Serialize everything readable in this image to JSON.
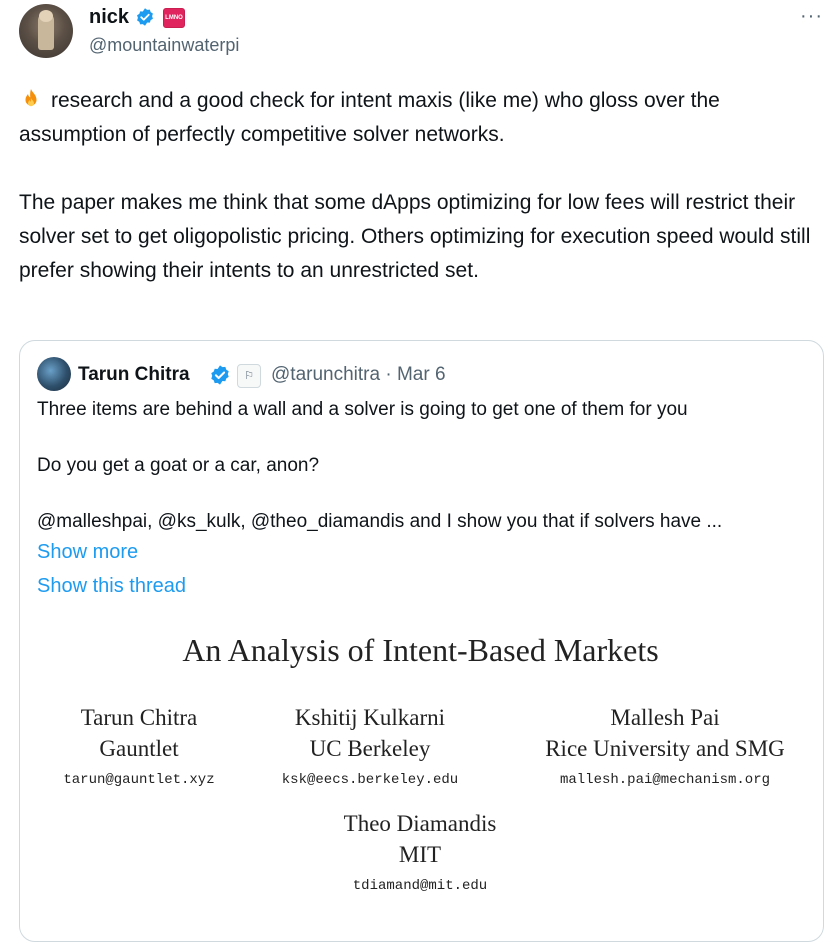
{
  "post": {
    "author_name": "nick",
    "author_handle": "@mountainwaterpi",
    "badge_text": "LMNO",
    "more_label": "···",
    "body_paragraph_1": "research and a good check for intent maxis (like me) who gloss over the assumption of perfectly competitive solver networks.",
    "body_paragraph_2": "The paper makes me think that some dApps optimizing for low fees will restrict their solver set to get oligopolistic pricing. Others optimizing for execution speed would still prefer showing their intents to an unrestricted set."
  },
  "quoted": {
    "author_name": "Tarun Chitra",
    "author_handle": "@tarunchitra · Mar 6",
    "line_1": "Three items are behind a wall and a solver is going to get one of them for you",
    "line_2": "Do you get a goat or a car, anon?",
    "line_3": "@malleshpai, @ks_kulk, @theo_diamandis and I show you that if solvers have ...",
    "show_more": "Show more",
    "show_thread": "Show this thread"
  },
  "paper": {
    "title": "An Analysis of Intent-Based Markets",
    "authors": [
      {
        "name": "Tarun Chitra",
        "affiliation": "Gauntlet",
        "email": "tarun@gauntlet.xyz"
      },
      {
        "name": "Kshitij Kulkarni",
        "affiliation": "UC Berkeley",
        "email": "ksk@eecs.berkeley.edu"
      },
      {
        "name": "Mallesh Pai",
        "affiliation": "Rice University and SMG",
        "email": "mallesh.pai@mechanism.org"
      },
      {
        "name": "Theo Diamandis",
        "affiliation": "MIT",
        "email": "tdiamand@mit.edu"
      }
    ]
  },
  "icons": {
    "verified": "verified-badge-icon",
    "fire": "fire-emoji-icon",
    "more": "more-options-icon"
  },
  "colors": {
    "link": "#1d9bf0",
    "verified": "#1d9bf0",
    "secondary_text": "#536471"
  }
}
